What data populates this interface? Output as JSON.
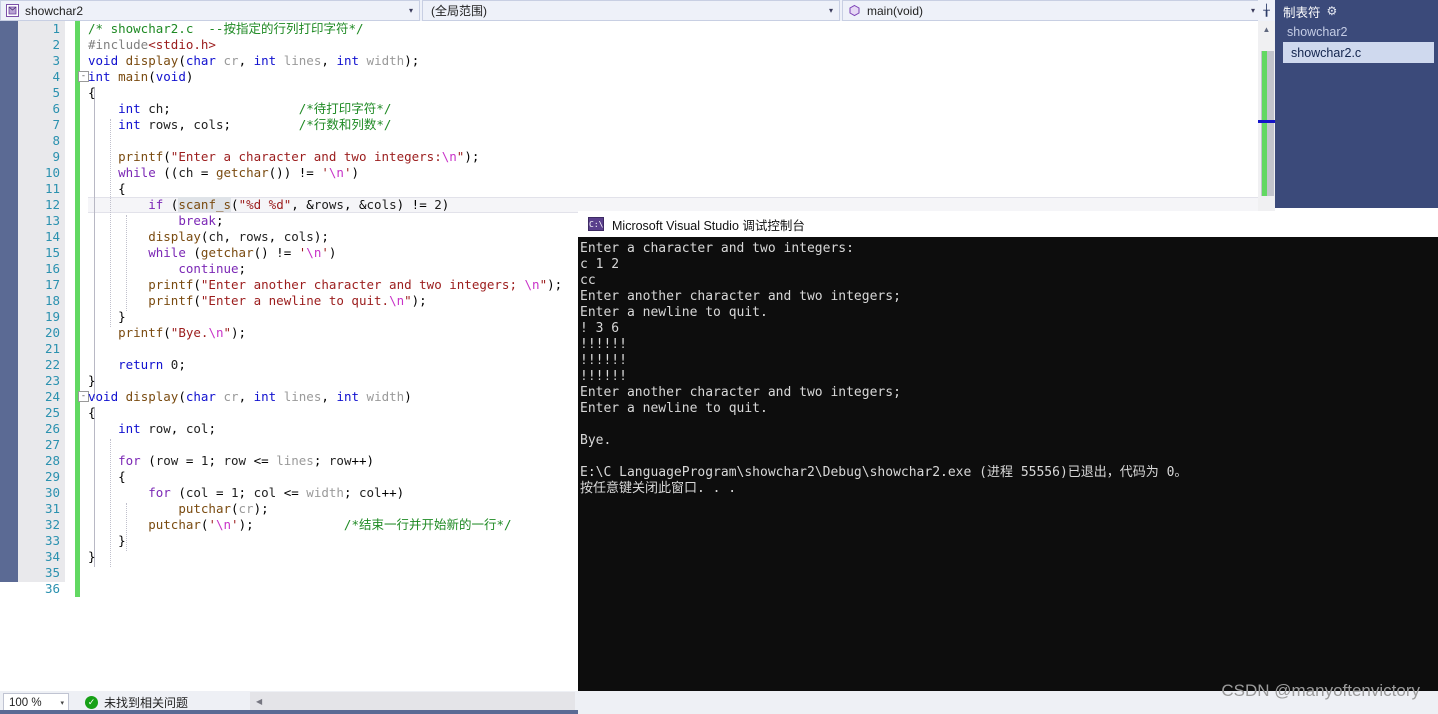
{
  "navbar": {
    "project_selector": {
      "label": "showchar2",
      "icon": "project-icon",
      "arrow": "▾"
    },
    "scope_selector": {
      "label": "(全局范围)",
      "arrow": "▾"
    },
    "member_selector": {
      "label": "main(void)",
      "icon": "method-icon",
      "arrow": "▾"
    },
    "splitter": "╁"
  },
  "right_panel": {
    "title": "制表符",
    "gear_icon": "gear-icon",
    "items": [
      {
        "label": "showchar2",
        "selected": false
      },
      {
        "label": "showchar2.c",
        "selected": true
      }
    ]
  },
  "editor": {
    "filename": "showchar2.c",
    "total_lines": 36,
    "current_line": 12,
    "selection_text": "scanf_s",
    "lines": [
      {
        "n": 1,
        "indent": 0
      },
      {
        "n": 2,
        "indent": 0
      },
      {
        "n": 3,
        "indent": 0
      },
      {
        "n": 4,
        "indent": 0,
        "fold": "-"
      },
      {
        "n": 5,
        "indent": 0
      },
      {
        "n": 6,
        "indent": 1
      },
      {
        "n": 7,
        "indent": 1
      },
      {
        "n": 8,
        "indent": 1
      },
      {
        "n": 9,
        "indent": 1
      },
      {
        "n": 10,
        "indent": 1
      },
      {
        "n": 11,
        "indent": 1
      },
      {
        "n": 12,
        "indent": 2
      },
      {
        "n": 13,
        "indent": 3
      },
      {
        "n": 14,
        "indent": 2
      },
      {
        "n": 15,
        "indent": 2
      },
      {
        "n": 16,
        "indent": 3
      },
      {
        "n": 17,
        "indent": 2
      },
      {
        "n": 18,
        "indent": 2
      },
      {
        "n": 19,
        "indent": 1
      },
      {
        "n": 20,
        "indent": 1
      },
      {
        "n": 21,
        "indent": 1
      },
      {
        "n": 22,
        "indent": 1
      },
      {
        "n": 23,
        "indent": 0
      },
      {
        "n": 24,
        "indent": 0,
        "fold": "-"
      },
      {
        "n": 25,
        "indent": 0
      },
      {
        "n": 26,
        "indent": 1
      },
      {
        "n": 27,
        "indent": 1
      },
      {
        "n": 28,
        "indent": 1
      },
      {
        "n": 29,
        "indent": 1
      },
      {
        "n": 30,
        "indent": 2
      },
      {
        "n": 31,
        "indent": 3
      },
      {
        "n": 32,
        "indent": 2
      },
      {
        "n": 33,
        "indent": 1
      },
      {
        "n": 34,
        "indent": 0
      },
      {
        "n": 35,
        "indent": 0
      },
      {
        "n": 36,
        "indent": 0
      }
    ],
    "code": [
      "/* showchar2.c  --按指定的行列打印字符*/",
      "#include<stdio.h>",
      "void display(char cr, int lines, int width);",
      "int main(void)",
      "{",
      "    int ch;                 /*待打印字符*/",
      "    int rows, cols;         /*行数和列数*/",
      "",
      "    printf(\"Enter a character and two integers:\\n\");",
      "    while ((ch = getchar()) != '\\n')",
      "    {",
      "        if (scanf_s(\"%d %d\", &rows, &cols) != 2)",
      "            break;",
      "        display(ch, rows, cols);",
      "        while (getchar() != '\\n')",
      "            continue;",
      "        printf(\"Enter another character and two integers; \\n\");",
      "        printf(\"Enter a newline to quit.\\n\");",
      "    }",
      "    printf(\"Bye.\\n\");",
      "",
      "    return 0;",
      "}",
      "void display(char cr, int lines, int width)",
      "{",
      "    int row, col;",
      "",
      "    for (row = 1; row <= lines; row++)",
      "    {",
      "        for (col = 1; col <= width; col++)",
      "            putchar(cr);",
      "        putchar('\\n');            /*结束一行并开始新的一行*/",
      "    }",
      "}",
      "",
      ""
    ]
  },
  "console": {
    "title": "Microsoft Visual Studio 调试控制台",
    "icon": "console-icon",
    "output": [
      "Enter a character and two integers:",
      "c 1 2",
      "cc",
      "Enter another character and two integers;",
      "Enter a newline to quit.",
      "! 3 6",
      "!!!!!!",
      "!!!!!!",
      "!!!!!!",
      "Enter another character and two integers;",
      "Enter a newline to quit.",
      "",
      "Bye.",
      "",
      "E:\\C LanguageProgram\\showchar2\\Debug\\showchar2.exe (进程 55556)已退出，代码为 0。",
      "按任意键关闭此窗口. . ."
    ]
  },
  "statusbar": {
    "zoom_level": "100 %",
    "zoom_arrow": "▾",
    "check_icon": "check-icon",
    "check_mark": "✓",
    "message": "未找到相关问题",
    "hscroll_arrow": "◀"
  },
  "watermark": "CSDN @manyoftenvictory",
  "colors": {
    "accent_blue": "#3b4a7a",
    "gutter_dark": "#5b6a94",
    "change_bar": "#62d862",
    "comment": "#1f8a24",
    "keyword": "#1010cf",
    "string": "#9b1c1c",
    "console_bg": "#0d0d0d"
  }
}
